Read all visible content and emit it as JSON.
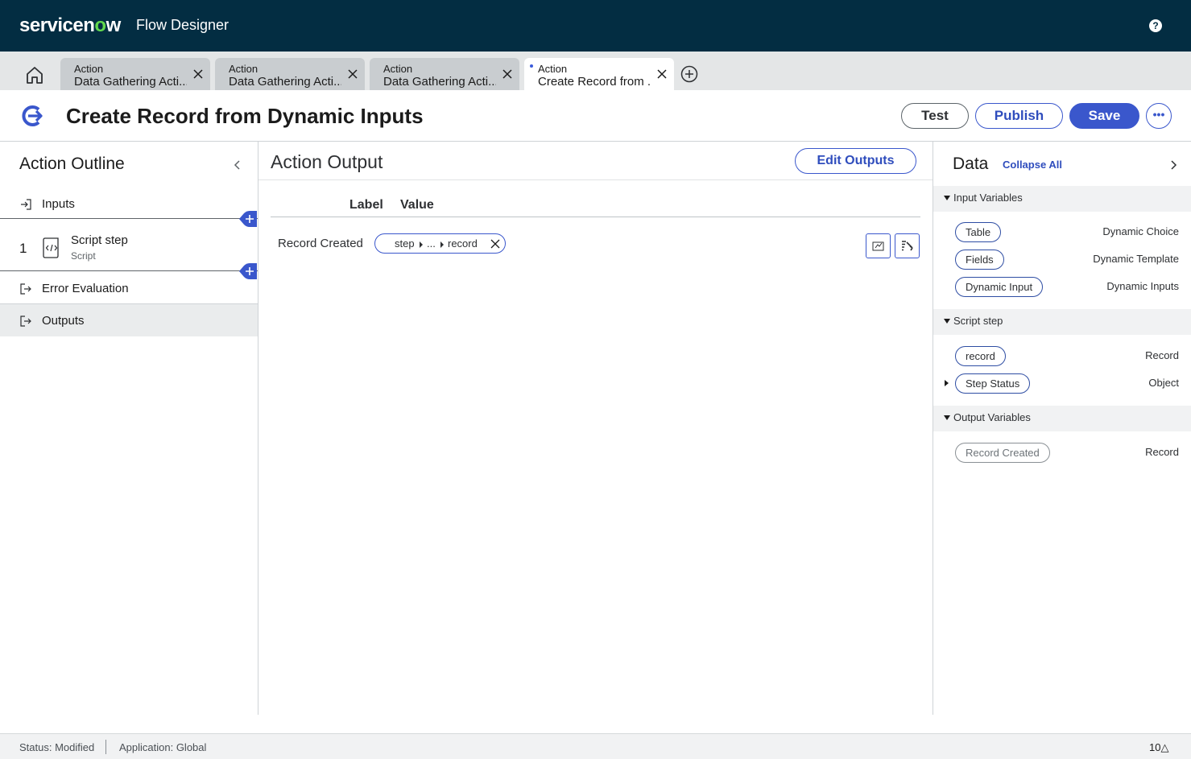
{
  "header": {
    "logo_text_a": "servicen",
    "logo_text_o": "o",
    "logo_text_b": "w",
    "app_name": "Flow Designer",
    "help_icon": "help-icon"
  },
  "tabs": [
    {
      "type": "Action",
      "name": "Data Gathering Acti...",
      "modified": false
    },
    {
      "type": "Action",
      "name": "Data Gathering Acti...",
      "modified": false
    },
    {
      "type": "Action",
      "name": "Data Gathering Acti...",
      "modified": false
    },
    {
      "type": "Action",
      "name": "Create Record from ...",
      "modified": true,
      "active": true
    }
  ],
  "title": {
    "text": "Create Record from Dynamic Inputs",
    "buttons": {
      "test": "Test",
      "publish": "Publish",
      "save": "Save",
      "more": "•••"
    }
  },
  "outline": {
    "title": "Action Outline",
    "inputs": "Inputs",
    "step_number": "1",
    "step_label": "Script step",
    "step_sub": "Script",
    "error": "Error Evaluation",
    "outputs": "Outputs"
  },
  "action_output": {
    "title": "Action Output",
    "edit_button": "Edit Outputs",
    "col_label": "Label",
    "col_value": "Value",
    "rows": [
      {
        "label": "Record Created",
        "pill": {
          "a": "step",
          "b": "...",
          "c": "record"
        }
      }
    ]
  },
  "data_panel": {
    "title": "Data",
    "collapse_all": "Collapse All",
    "sections": [
      {
        "label": "Input Variables",
        "items": [
          {
            "name": "Table",
            "type": "Dynamic Choice"
          },
          {
            "name": "Fields",
            "type": "Dynamic Template"
          },
          {
            "name": "Dynamic Input",
            "type": "Dynamic Inputs"
          }
        ]
      },
      {
        "label": "Script step",
        "items": [
          {
            "name": "record",
            "type": "Record"
          },
          {
            "name": "Step Status",
            "type": "Object"
          }
        ]
      },
      {
        "label": "Output Variables",
        "items": [
          {
            "name": "Record Created",
            "type": "Record"
          }
        ]
      }
    ]
  },
  "status": {
    "status": "Status: Modified",
    "application": "Application: Global",
    "notifications": "10"
  },
  "colors": {
    "header_bg": "#032d42",
    "accent": "#3a57cc",
    "logo_accent": "#62d84e"
  }
}
